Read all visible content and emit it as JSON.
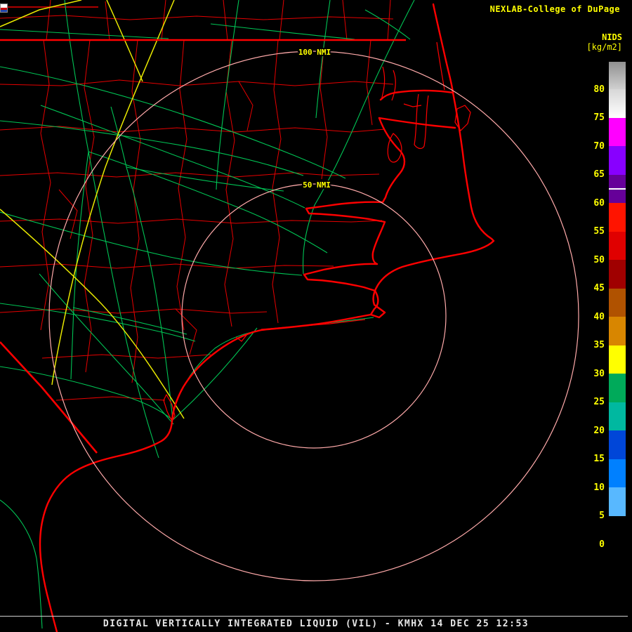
{
  "header": {
    "brand": "NEXLAB-College of DuPage"
  },
  "legend": {
    "title": "NIDS",
    "units": "[kg/m2]",
    "tick_values": [
      80,
      75,
      70,
      65,
      60,
      55,
      50,
      45,
      40,
      35,
      30,
      25,
      20,
      15,
      10,
      5,
      0
    ],
    "segments": [
      {
        "v0": 80,
        "v1": 84.8,
        "color": "#909090",
        "color2": "#d0d0d0"
      },
      {
        "v0": 75,
        "v1": 80,
        "color": "#d6d6d6",
        "color2": "#ffffff"
      },
      {
        "v0": 70,
        "v1": 75,
        "color": "#ff00ff"
      },
      {
        "v0": 65,
        "v1": 70,
        "color": "#8800ff"
      },
      {
        "v0": 60,
        "v1": 65,
        "color": "#660099",
        "marker": true
      },
      {
        "v0": 55,
        "v1": 60,
        "color": "#ff1400"
      },
      {
        "v0": 50,
        "v1": 55,
        "color": "#e00000"
      },
      {
        "v0": 45,
        "v1": 50,
        "color": "#a00000"
      },
      {
        "v0": 40,
        "v1": 45,
        "color": "#b05200"
      },
      {
        "v0": 35,
        "v1": 40,
        "color": "#d88600"
      },
      {
        "v0": 30,
        "v1": 35,
        "color": "#ffff00"
      },
      {
        "v0": 25,
        "v1": 30,
        "color": "#00aa5a"
      },
      {
        "v0": 20,
        "v1": 25,
        "color": "#00b8a0"
      },
      {
        "v0": 15,
        "v1": 20,
        "color": "#0046d8"
      },
      {
        "v0": 10,
        "v1": 15,
        "color": "#0080ff"
      },
      {
        "v0": 5,
        "v1": 10,
        "color": "#58b8ff"
      },
      {
        "v0": 0,
        "v1": 5,
        "color": "#000000"
      },
      {
        "v0": -2,
        "v1": 0,
        "color": "#000000"
      }
    ]
  },
  "map": {
    "ring_label_inner": "50 NMI",
    "ring_label_outer": "100 NMI",
    "colors": {
      "coastline": "#ff0000",
      "county_lines": "#e60000",
      "roads_primary": "#00c455",
      "roads_interstate": "#e8e800",
      "range_rings": "#ffaaaa",
      "labels": "#ffff00"
    }
  },
  "footer": {
    "caption": "DIGITAL VERTICALLY INTEGRATED LIQUID (VIL) - KMHX 14 DEC 25 12:53"
  }
}
